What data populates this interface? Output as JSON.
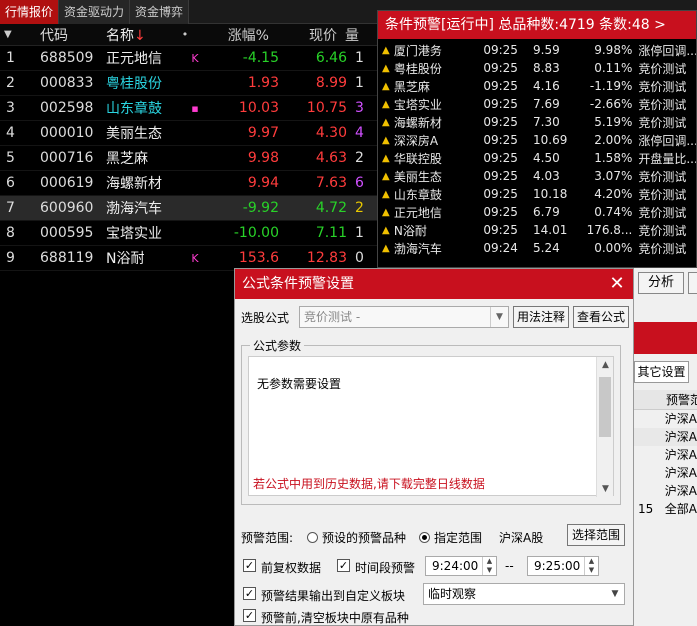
{
  "tabs": [
    "行情报价",
    "资金驱动力",
    "资金博弈"
  ],
  "quote": {
    "headers": {
      "code": "代码",
      "name": "名称",
      "sort_arrow": "↓",
      "dot": "•",
      "chg": "涨幅%",
      "price": "现价",
      "more": "量"
    },
    "rows": [
      {
        "idx": "1",
        "code": "688509",
        "name": "正元地信",
        "flag": "K",
        "chg": "-4.15",
        "price": "6.46",
        "more": "1",
        "dir": "down",
        "name_color": "white"
      },
      {
        "idx": "2",
        "code": "000833",
        "name": "粤桂股份",
        "flag": "",
        "chg": "1.93",
        "price": "8.99",
        "more": "1",
        "dir": "up",
        "name_color": "cyan"
      },
      {
        "idx": "3",
        "code": "002598",
        "name": "山东章鼓",
        "flag": "▪",
        "chg": "10.03",
        "price": "10.75",
        "more": "3",
        "dir": "up",
        "name_color": "cyan"
      },
      {
        "idx": "4",
        "code": "000010",
        "name": "美丽生态",
        "flag": "",
        "chg": "9.97",
        "price": "4.30",
        "more": "4",
        "dir": "up",
        "name_color": "white"
      },
      {
        "idx": "5",
        "code": "000716",
        "name": "黑芝麻",
        "flag": "",
        "chg": "9.98",
        "price": "4.63",
        "more": "2",
        "dir": "up",
        "name_color": "white"
      },
      {
        "idx": "6",
        "code": "000619",
        "name": "海螺新材",
        "flag": "",
        "chg": "9.94",
        "price": "7.63",
        "more": "6",
        "dir": "up",
        "name_color": "white"
      },
      {
        "idx": "7",
        "code": "600960",
        "name": "渤海汽车",
        "flag": "",
        "chg": "-9.92",
        "price": "4.72",
        "more": "2",
        "dir": "down",
        "name_color": "white"
      },
      {
        "idx": "8",
        "code": "000595",
        "name": "宝塔实业",
        "flag": "",
        "chg": "-10.00",
        "price": "7.11",
        "more": "1",
        "dir": "down",
        "name_color": "white"
      },
      {
        "idx": "9",
        "code": "688119",
        "name": "N浴耐",
        "flag": "K",
        "chg": "153.6",
        "price": "12.83",
        "more": "0",
        "dir": "up",
        "name_color": "white"
      }
    ]
  },
  "alert": {
    "title": "条件预警[运行中] 总品种数:4719 条数:48  >",
    "rows": [
      {
        "name": "厦门港务",
        "time": "09:25",
        "price": "9.59",
        "pct": "9.98%",
        "cond": "涨停回调..."
      },
      {
        "name": "粤桂股份",
        "time": "09:25",
        "price": "8.83",
        "pct": "0.11%",
        "cond": "竞价测试"
      },
      {
        "name": "黑芝麻",
        "time": "09:25",
        "price": "4.16",
        "pct": "-1.19%",
        "cond": "竞价测试"
      },
      {
        "name": "宝塔实业",
        "time": "09:25",
        "price": "7.69",
        "pct": "-2.66%",
        "cond": "竞价测试"
      },
      {
        "name": "海螺新材",
        "time": "09:25",
        "price": "7.30",
        "pct": "5.19%",
        "cond": "竞价测试"
      },
      {
        "name": "深深房A",
        "time": "09:25",
        "price": "10.69",
        "pct": "2.00%",
        "cond": "涨停回调..."
      },
      {
        "name": "华联控股",
        "time": "09:25",
        "price": "4.50",
        "pct": "1.58%",
        "cond": "开盘量比..."
      },
      {
        "name": "美丽生态",
        "time": "09:25",
        "price": "4.03",
        "pct": "3.07%",
        "cond": "竞价测试"
      },
      {
        "name": "山东章鼓",
        "time": "09:25",
        "price": "10.18",
        "pct": "4.20%",
        "cond": "竞价测试"
      },
      {
        "name": "正元地信",
        "time": "09:25",
        "price": "6.79",
        "pct": "0.74%",
        "cond": "竞价测试"
      },
      {
        "name": "N浴耐",
        "time": "09:25",
        "price": "14.01",
        "pct": "176.8...",
        "cond": "竞价测试"
      },
      {
        "name": "渤海汽车",
        "time": "09:24",
        "price": "5.24",
        "pct": "0.00%",
        "cond": "竞价测试"
      }
    ]
  },
  "right": {
    "analyze_btn": "分析",
    "other_tab": "其它设置",
    "list_header": "预警范",
    "list": [
      {
        "n": "",
        "v": "沪深A"
      },
      {
        "n": "",
        "v": "沪深A"
      },
      {
        "n": "",
        "v": "沪深A"
      },
      {
        "n": "",
        "v": "沪深A"
      },
      {
        "n": "",
        "v": "沪深A"
      },
      {
        "n": "15",
        "v": "全部A"
      }
    ]
  },
  "dialog": {
    "title": "公式条件预警设置",
    "close": "✕",
    "formula_label": "选股公式",
    "formula_value": "竞价测试    -",
    "usage_btn": "用法注释",
    "view_btn": "查看公式",
    "params_title": "公式参数",
    "params_msg": "无参数需要设置",
    "warn": "若公式中用到历史数据,请下载完整日线数据",
    "range_label": "预警范围:",
    "range_opt1": "预设的预警品种",
    "range_opt2": "指定范围",
    "range_value": "沪深A股",
    "select_range_btn": "选择范围",
    "chk_fq": "前复权数据",
    "chk_time": "时间段预警",
    "time_from": "9:24:00",
    "time_sep": "--",
    "time_to": "9:25:00",
    "chk_output": "预警结果输出到自定义板块",
    "block_value": "临时观察",
    "chk_clear": "预警前,清空板块中原有品种"
  }
}
